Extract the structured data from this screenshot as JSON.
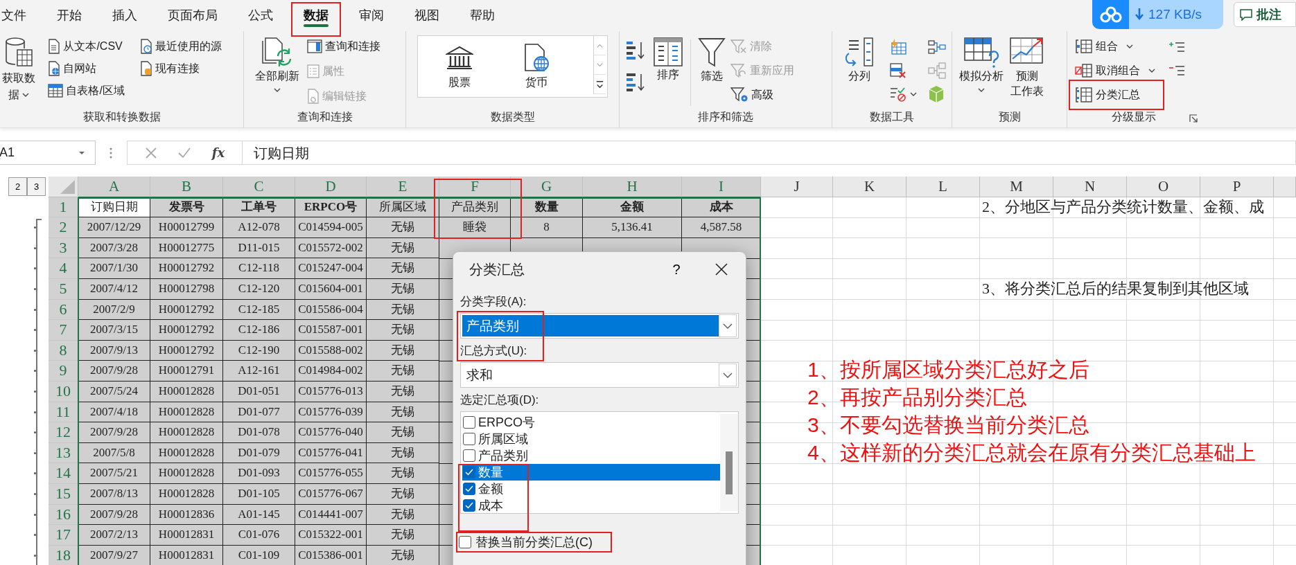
{
  "ribbon_tabs": [
    {
      "label": "文件",
      "selected": false
    },
    {
      "label": "开始",
      "selected": false
    },
    {
      "label": "插入",
      "selected": false
    },
    {
      "label": "页面布局",
      "selected": false
    },
    {
      "label": "公式",
      "selected": false
    },
    {
      "label": "数据",
      "selected": true
    },
    {
      "label": "审阅",
      "selected": false
    },
    {
      "label": "视图",
      "selected": false
    },
    {
      "label": "帮助",
      "selected": false
    }
  ],
  "sync_badge": {
    "speed": "127 KB/s"
  },
  "comment_button": {
    "label": "批注"
  },
  "ribbon_groups": [
    {
      "label": "获取和转换数据",
      "buttons": [
        {
          "label": "获取数据",
          "disabled": false
        },
        {
          "label": "从文本/CSV",
          "disabled": false
        },
        {
          "label": "自网站",
          "disabled": false
        },
        {
          "label": "自表格/区域",
          "disabled": false
        },
        {
          "label": "最近使用的源",
          "disabled": false
        },
        {
          "label": "现有连接",
          "disabled": false
        }
      ]
    },
    {
      "label": "查询和连接",
      "buttons": [
        {
          "label": "全部刷新",
          "disabled": false
        },
        {
          "label": "查询和连接",
          "disabled": false
        },
        {
          "label": "属性",
          "disabled": true
        },
        {
          "label": "编辑链接",
          "disabled": true
        }
      ]
    },
    {
      "label": "数据类型",
      "buttons": [
        {
          "label": "股票",
          "disabled": false
        },
        {
          "label": "货币",
          "disabled": false
        }
      ]
    },
    {
      "label": "排序和筛选",
      "buttons": [
        {
          "label": "排序",
          "disabled": false
        },
        {
          "label": "筛选",
          "disabled": false
        },
        {
          "label": "清除",
          "disabled": true
        },
        {
          "label": "重新应用",
          "disabled": true
        },
        {
          "label": "高级",
          "disabled": false
        }
      ]
    },
    {
      "label": "数据工具",
      "buttons": [
        {
          "label": "分列",
          "disabled": false
        }
      ]
    },
    {
      "label": "预测",
      "buttons": [
        {
          "label": "模拟分析",
          "disabled": false
        },
        {
          "lines": [
            "预测",
            "工作表"
          ],
          "disabled": false
        }
      ]
    },
    {
      "label": "分级显示",
      "buttons": [
        {
          "label": "组合",
          "disabled": false
        },
        {
          "label": "取消组合",
          "disabled": false
        },
        {
          "label": "分类汇总",
          "disabled": false
        }
      ]
    }
  ],
  "formula_bar": {
    "name_box": "A1",
    "fx": "fx",
    "content": "订购日期"
  },
  "outline_levels": [
    "2",
    "3"
  ],
  "columns": [
    {
      "letter": "A",
      "selected": true
    },
    {
      "letter": "B",
      "selected": true
    },
    {
      "letter": "C",
      "selected": true
    },
    {
      "letter": "D",
      "selected": true
    },
    {
      "letter": "E",
      "selected": true
    },
    {
      "letter": "F",
      "selected": true
    },
    {
      "letter": "G",
      "selected": true
    },
    {
      "letter": "H",
      "selected": true
    },
    {
      "letter": "I",
      "selected": true
    },
    {
      "letter": "J",
      "selected": false
    },
    {
      "letter": "K",
      "selected": false
    },
    {
      "letter": "L",
      "selected": false
    },
    {
      "letter": "M",
      "selected": false
    },
    {
      "letter": "N",
      "selected": false
    },
    {
      "letter": "O",
      "selected": false
    },
    {
      "letter": "P",
      "selected": false
    }
  ],
  "header_row": {
    "number": "1",
    "selected": true,
    "note": "2、分地区与产品分类统计数量、金额、成",
    "cells": [
      {
        "text": "订购日期",
        "bold": false,
        "active": true
      },
      {
        "text": "发票号",
        "bold": true,
        "active": false
      },
      {
        "text": "工单号",
        "bold": true,
        "active": false
      },
      {
        "text": "ERPCO号",
        "bold": true,
        "active": false
      },
      {
        "text": "所属区域",
        "bold": false,
        "active": false
      },
      {
        "text": "产品类别",
        "bold": false,
        "active": false
      },
      {
        "text": "数量",
        "bold": true,
        "active": false
      },
      {
        "text": "金额",
        "bold": true,
        "active": false
      },
      {
        "text": "成本",
        "bold": true,
        "active": false
      }
    ]
  },
  "rows": [
    {
      "number": "2",
      "selected": true,
      "cells": [
        "2007/12/29",
        "H00012799",
        "A12-078",
        "C014594-005",
        "无锡",
        "睡袋",
        "8",
        "5,136.41",
        "4,587.58"
      ]
    },
    {
      "number": "3",
      "selected": true,
      "cells": [
        "2007/3/28",
        "H00012775",
        "D11-015",
        "C015572-002",
        "无锡"
      ]
    },
    {
      "number": "4",
      "selected": true,
      "cells": [
        "2007/1/30",
        "H00012792",
        "C12-118",
        "C015247-004",
        "无锡"
      ]
    },
    {
      "number": "5",
      "selected": true,
      "note": "3、将分类汇总后的结果复制到其他区域",
      "cells": [
        "2007/4/12",
        "H00012798",
        "C12-120",
        "C015604-001",
        "无锡"
      ]
    },
    {
      "number": "6",
      "selected": true,
      "cells": [
        "2007/2/9",
        "H00012792",
        "C12-185",
        "C015586-004",
        "无锡"
      ]
    },
    {
      "number": "7",
      "selected": true,
      "cells": [
        "2007/3/15",
        "H00012792",
        "C12-186",
        "C015587-001",
        "无锡"
      ]
    },
    {
      "number": "8",
      "selected": true,
      "cells": [
        "2007/9/13",
        "H00012792",
        "C12-190",
        "C015588-002",
        "无锡"
      ]
    },
    {
      "number": "9",
      "selected": true,
      "cells": [
        "2007/9/28",
        "H00012791",
        "A12-161",
        "C014984-002",
        "无锡"
      ]
    },
    {
      "number": "10",
      "selected": true,
      "cells": [
        "2007/5/24",
        "H00012828",
        "D01-051",
        "C015776-013",
        "无锡"
      ]
    },
    {
      "number": "11",
      "selected": true,
      "cells": [
        "2007/4/18",
        "H00012828",
        "D01-077",
        "C015776-039",
        "无锡"
      ]
    },
    {
      "number": "12",
      "selected": true,
      "cells": [
        "2007/9/28",
        "H00012828",
        "D01-078",
        "C015776-040",
        "无锡"
      ]
    },
    {
      "number": "13",
      "selected": true,
      "cells": [
        "2007/5/8",
        "H00012828",
        "D01-079",
        "C015776-041",
        "无锡"
      ]
    },
    {
      "number": "14",
      "selected": true,
      "cells": [
        "2007/5/21",
        "H00012828",
        "D01-093",
        "C015776-055",
        "无锡"
      ]
    },
    {
      "number": "15",
      "selected": true,
      "cells": [
        "2007/8/13",
        "H00012828",
        "D01-105",
        "C015776-067",
        "无锡"
      ]
    },
    {
      "number": "16",
      "selected": true,
      "cells": [
        "2007/9/28",
        "H00012836",
        "A01-145",
        "C014441-007",
        "无锡"
      ]
    },
    {
      "number": "17",
      "selected": true,
      "cells": [
        "2007/2/13",
        "H00012831",
        "C01-076",
        "C015322-001",
        "无锡"
      ]
    },
    {
      "number": "18",
      "selected": true,
      "cells": [
        "2007/9/27",
        "H00012831",
        "C01-109",
        "C015386-001",
        "无锡"
      ]
    }
  ],
  "dialog": {
    "title": "分类汇总",
    "help": "?",
    "field_label": "分类字段(A):",
    "field_value": "产品类别",
    "function_label": "汇总方式(U):",
    "function_value": "求和",
    "items_label": "选定汇总项(D):",
    "items": [
      {
        "label": "ERPCO号",
        "checked": false,
        "selected": false
      },
      {
        "label": "所属区域",
        "checked": false,
        "selected": false
      },
      {
        "label": "产品类别",
        "checked": false,
        "selected": false
      },
      {
        "label": "数量",
        "checked": true,
        "selected": true
      },
      {
        "label": "金额",
        "checked": true,
        "selected": false
      },
      {
        "label": "成本",
        "checked": true,
        "selected": false
      }
    ],
    "options": [
      {
        "label": "替换当前分类汇总(C)",
        "checked": false
      }
    ]
  },
  "annotations": [
    "1、按所属区域分类汇总好之后",
    "2、再按产品别分类汇总",
    "3、不要勾选替换当前分类汇总",
    "4、这样新的分类汇总就会在原有分类汇总基础上"
  ]
}
